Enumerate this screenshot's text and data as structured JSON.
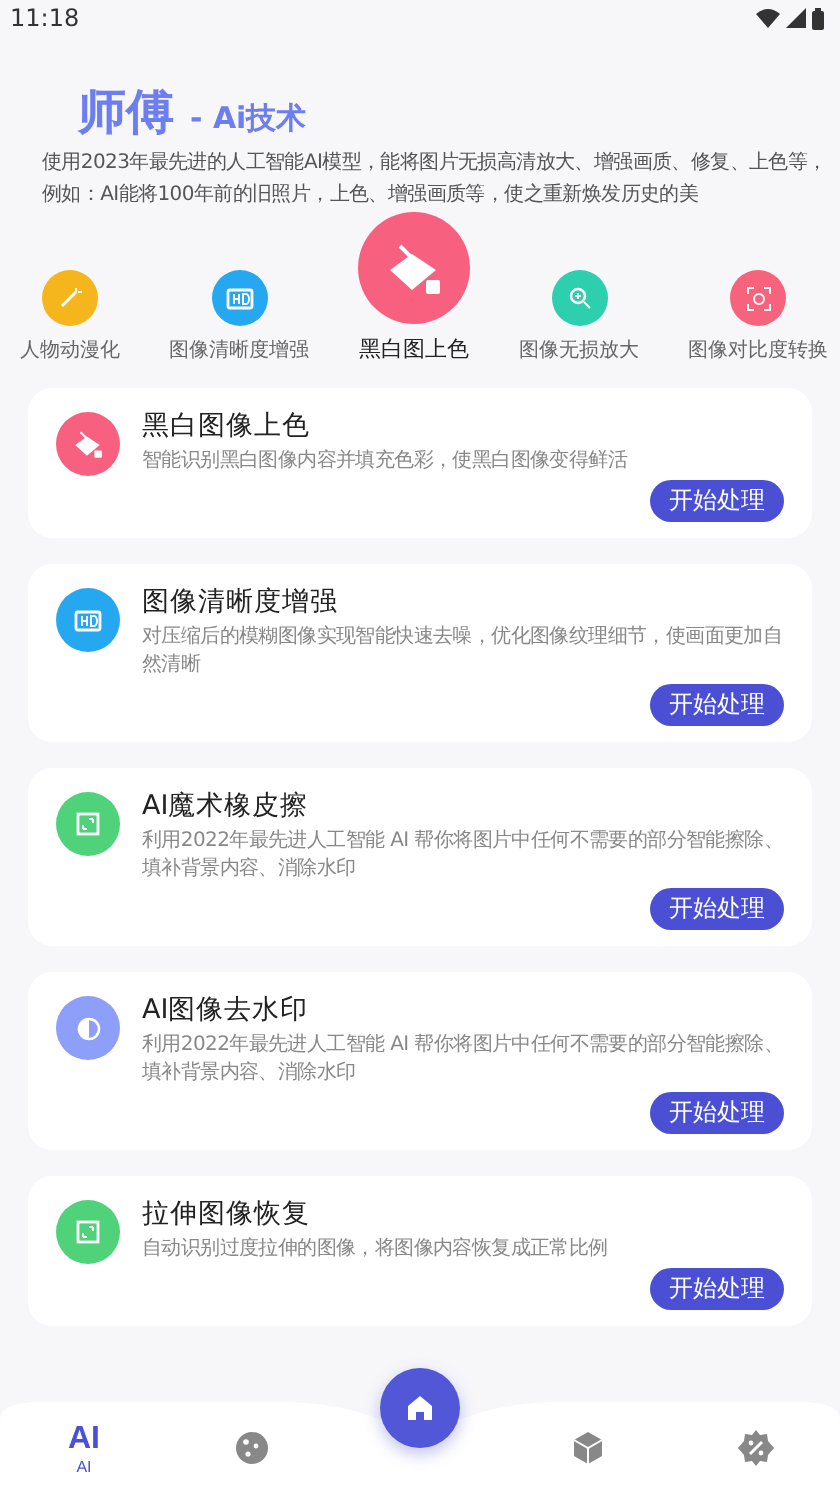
{
  "status_bar": {
    "time": "11:18"
  },
  "header": {
    "title": "师傅",
    "subtitle": "- Ai技术",
    "description": "使用2023年最先进的人工智能AI模型，能将图片无损高清放大、增强画质、修复、上色等，例如：AI能将100年前的旧照片，上色、增强画质等，使之重新焕发历史的美"
  },
  "shortcuts": [
    {
      "label": "人物动漫化",
      "kind": "wand",
      "color": "#f5b51c",
      "featured": false
    },
    {
      "label": "图像清晰度增强",
      "kind": "hd",
      "color": "#25a8f0",
      "featured": false
    },
    {
      "label": "黑白图上色",
      "kind": "bucket",
      "color": "#f7607e",
      "featured": true
    },
    {
      "label": "图像无损放大",
      "kind": "zoom",
      "color": "#2ecfae",
      "featured": false
    },
    {
      "label": "图像对比度转换",
      "kind": "focus",
      "color": "#f7637c",
      "featured": false
    }
  ],
  "cards": [
    {
      "title": "黑白图像上色",
      "description": "智能识别黑白图像内容并填充色彩，使黑白图像变得鲜活",
      "kind": "bucket",
      "color": "#f7607e",
      "button": "开始处理"
    },
    {
      "title": "图像清晰度增强",
      "description": "对压缩后的模糊图像实现智能快速去噪，优化图像纹理细节，使画面更加自然清晰",
      "kind": "hd",
      "color": "#25a8f0",
      "button": "开始处理"
    },
    {
      "title": "AI魔术橡皮擦",
      "description": "利用2022年最先进人工智能 AI 帮你将图片中任何不需要的部分智能擦除、填补背景内容、消除水印",
      "kind": "frame",
      "color": "#4fd27a",
      "button": "开始处理"
    },
    {
      "title": "AI图像去水印",
      "description": "利用2022年最先进人工智能 AI 帮你将图片中任何不需要的部分智能擦除、填补背景内容、消除水印",
      "kind": "contrast",
      "color": "#8d9ff8",
      "button": "开始处理"
    },
    {
      "title": "拉伸图像恢复",
      "description": "自动识别过度拉伸的图像，将图像内容恢复成正常比例",
      "kind": "frame",
      "color": "#4fd27a",
      "button": "开始处理"
    }
  ],
  "bottom_nav": [
    {
      "kind": "text",
      "text": "AI",
      "label": "AI",
      "selected": true
    },
    {
      "kind": "cookie",
      "selected": false
    },
    {
      "kind": "home",
      "selected": false
    },
    {
      "kind": "cube",
      "selected": false
    },
    {
      "kind": "badge",
      "selected": false
    }
  ]
}
